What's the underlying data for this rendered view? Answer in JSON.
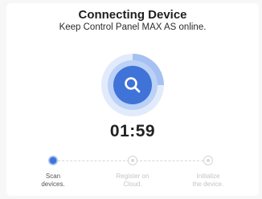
{
  "header": {
    "title": "Connecting Device",
    "subtitle": "Keep Control Panel MAX AS online."
  },
  "scan": {
    "icon": "search-icon",
    "timer": "01:59"
  },
  "steps": [
    {
      "label": "Scan\ndevices.",
      "state": "active"
    },
    {
      "label": "Register on\nCloud.",
      "state": "pending"
    },
    {
      "label": "Initialize\nthe device.",
      "state": "pending"
    }
  ],
  "colors": {
    "accent": "#3f73d8",
    "ring": "#bcd1f6",
    "text": "#222222",
    "muted": "#c4c4c4"
  }
}
